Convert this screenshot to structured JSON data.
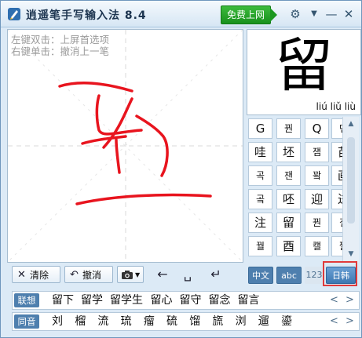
{
  "window": {
    "title": "逍遥笔手写输入法 8.4",
    "free_internet": "免费上网"
  },
  "canvas": {
    "hints": [
      "左键双击：上屏首选项",
      "右键单击：撤消上一笔"
    ]
  },
  "toolbar": {
    "clear_label": "清除",
    "undo_label": "撤消"
  },
  "preview": {
    "char": "留",
    "pinyin": "liú liǔ liù"
  },
  "char_grid": [
    [
      "G",
      "꿘",
      "Q",
      "댄"
    ],
    [
      "哇",
      "坯",
      "잼",
      "苗"
    ],
    [
      "곡",
      "잰",
      "꽠",
      "画"
    ],
    [
      "곸",
      "呸",
      "迎",
      "进"
    ],
    [
      "注",
      "留",
      "꿘",
      "갤"
    ],
    [
      "꿜",
      "酉",
      "캘",
      "짤"
    ]
  ],
  "modes": [
    "中文",
    "abc",
    "123",
    "日韩"
  ],
  "candidates": {
    "association": {
      "tag": "联想",
      "words": [
        "留下",
        "留学",
        "留学生",
        "留心",
        "留守",
        "留念",
        "留言"
      ]
    },
    "homophone": {
      "tag": "同音",
      "words": [
        "刘",
        "榴",
        "流",
        "琉",
        "瘤",
        "硫",
        "馏",
        "旒",
        "浏",
        "遛",
        "鎏"
      ]
    }
  },
  "colors": {
    "stroke": "#e8141e",
    "accent": "#4e7fae",
    "free_button": "#1f9a22",
    "highlight_box": "#e03b3b"
  }
}
